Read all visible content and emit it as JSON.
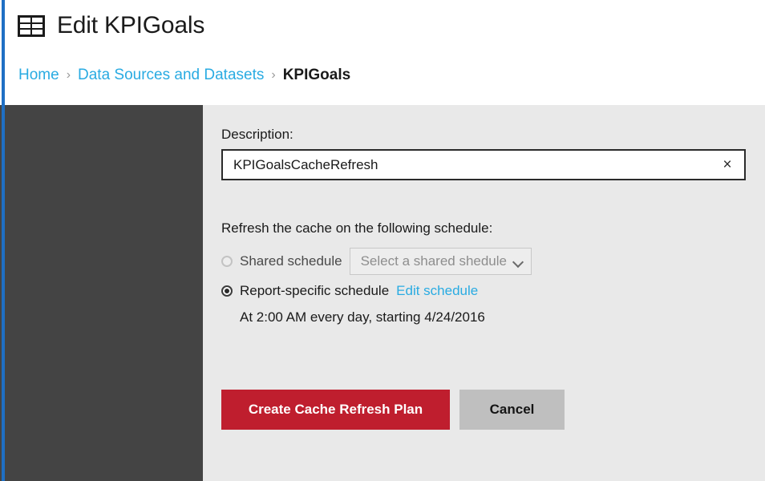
{
  "header": {
    "icon": "table-grid-icon",
    "title": "Edit KPIGoals",
    "breadcrumb": {
      "home_label": "Home",
      "separator": "›",
      "section_label": "Data Sources and Datasets",
      "current_label": "KPIGoals"
    }
  },
  "form": {
    "description_label": "Description:",
    "description_value": "KPIGoalsCacheRefresh",
    "description_placeholder": "",
    "clear_icon": "×",
    "schedule_section_label": "Refresh the cache on the following schedule:",
    "shared_schedule": {
      "label": "Shared schedule",
      "selected": false,
      "dropdown_value": "Select a shared shedule",
      "dropdown_icon": "chevron-down-icon"
    },
    "report_schedule": {
      "label": "Report-specific schedule",
      "selected": true,
      "edit_link_label": "Edit schedule",
      "summary": "At 2:00 AM every day, starting 4/24/2016"
    }
  },
  "actions": {
    "primary_label": "Create Cache Refresh Plan",
    "secondary_label": "Cancel"
  },
  "colors": {
    "accent_link": "#29abe2",
    "primary_button": "#bf1e2e",
    "secondary_button": "#bfbfbf",
    "rail": "#444444",
    "content_bg": "#e9e9e9",
    "edge_strip": "#1f6fc4"
  }
}
